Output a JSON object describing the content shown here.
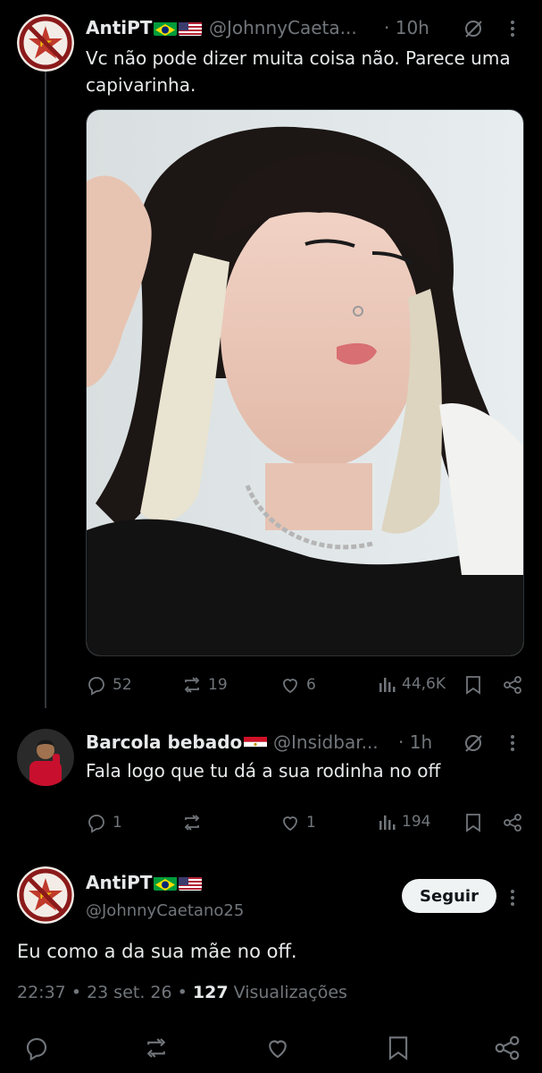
{
  "tweet1": {
    "name": "AntiPT",
    "handle": "@JohnnyCaeta...",
    "time": "· 10h",
    "text": "Vc não pode dizer muita coisa não. Parece uma capivarinha.",
    "flags": [
      "brazil-flag",
      "usa-flag"
    ],
    "stats": {
      "replies": "52",
      "reposts": "19",
      "likes": "6",
      "views": "44,6K"
    }
  },
  "tweet2": {
    "name": "Barcola bebado",
    "handle": "@Insidbar...",
    "time": "· 1h",
    "text": "Fala logo que tu dá a sua rodinha no off",
    "flags": [
      "egypt-flag"
    ],
    "stats": {
      "replies": "1",
      "reposts": "",
      "likes": "1",
      "views": "194"
    }
  },
  "main_tweet": {
    "name": "AntiPT",
    "handle": "@JohnnyCaetano25",
    "follow_label": "Seguir",
    "text": "Eu como a da sua mãe no off.",
    "time": "22:37",
    "date": "23 set. 26",
    "views_count": "127",
    "views_label": "Visualizações",
    "sep": "•",
    "flags": [
      "brazil-flag",
      "usa-flag"
    ]
  },
  "colors": {
    "background": "#000000",
    "text": "#e7e9ea",
    "muted": "#71767b",
    "button_bg": "#eff3f4"
  }
}
